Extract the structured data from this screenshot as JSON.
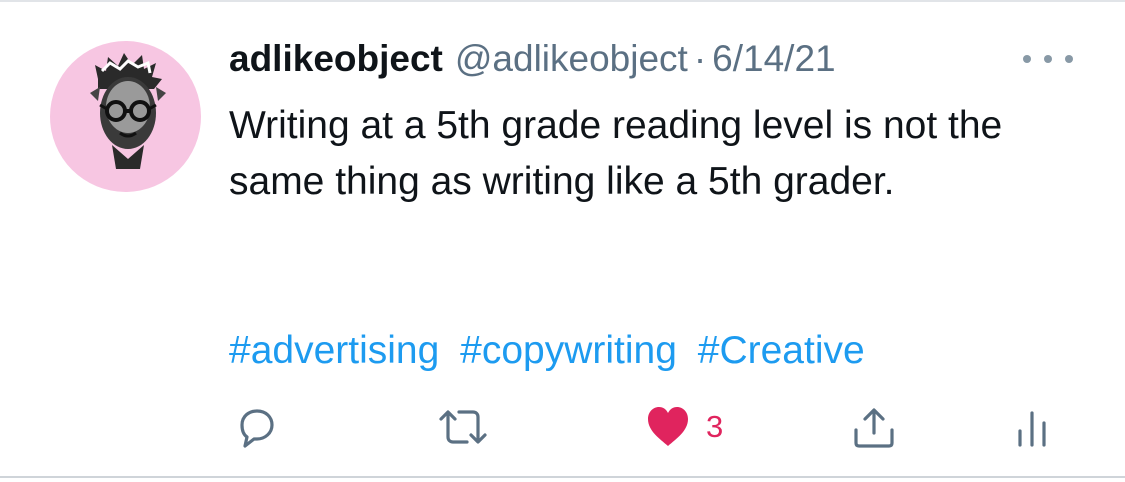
{
  "tweet": {
    "display_name": "adlikeobject",
    "handle": "@adlikeobject",
    "separator": "·",
    "date": "6/14/21",
    "text": "Writing at a 5th grade reading level is not the same thing as writing like a 5th grader.",
    "hashtags": [
      "#advertising",
      "#copywriting",
      "#Creative"
    ]
  },
  "actions": {
    "reply_icon": "reply-bubble-icon",
    "retweet_icon": "retweet-icon",
    "like_icon": "heart-filled-icon",
    "like_count": "3",
    "share_icon": "share-upload-icon",
    "analytics_icon": "analytics-bars-icon"
  },
  "colors": {
    "text": "#0f1419",
    "secondary": "#5b7083",
    "link": "#1d9bf0",
    "like": "#e0245e",
    "avatar_bg": "#f7c6e2"
  }
}
